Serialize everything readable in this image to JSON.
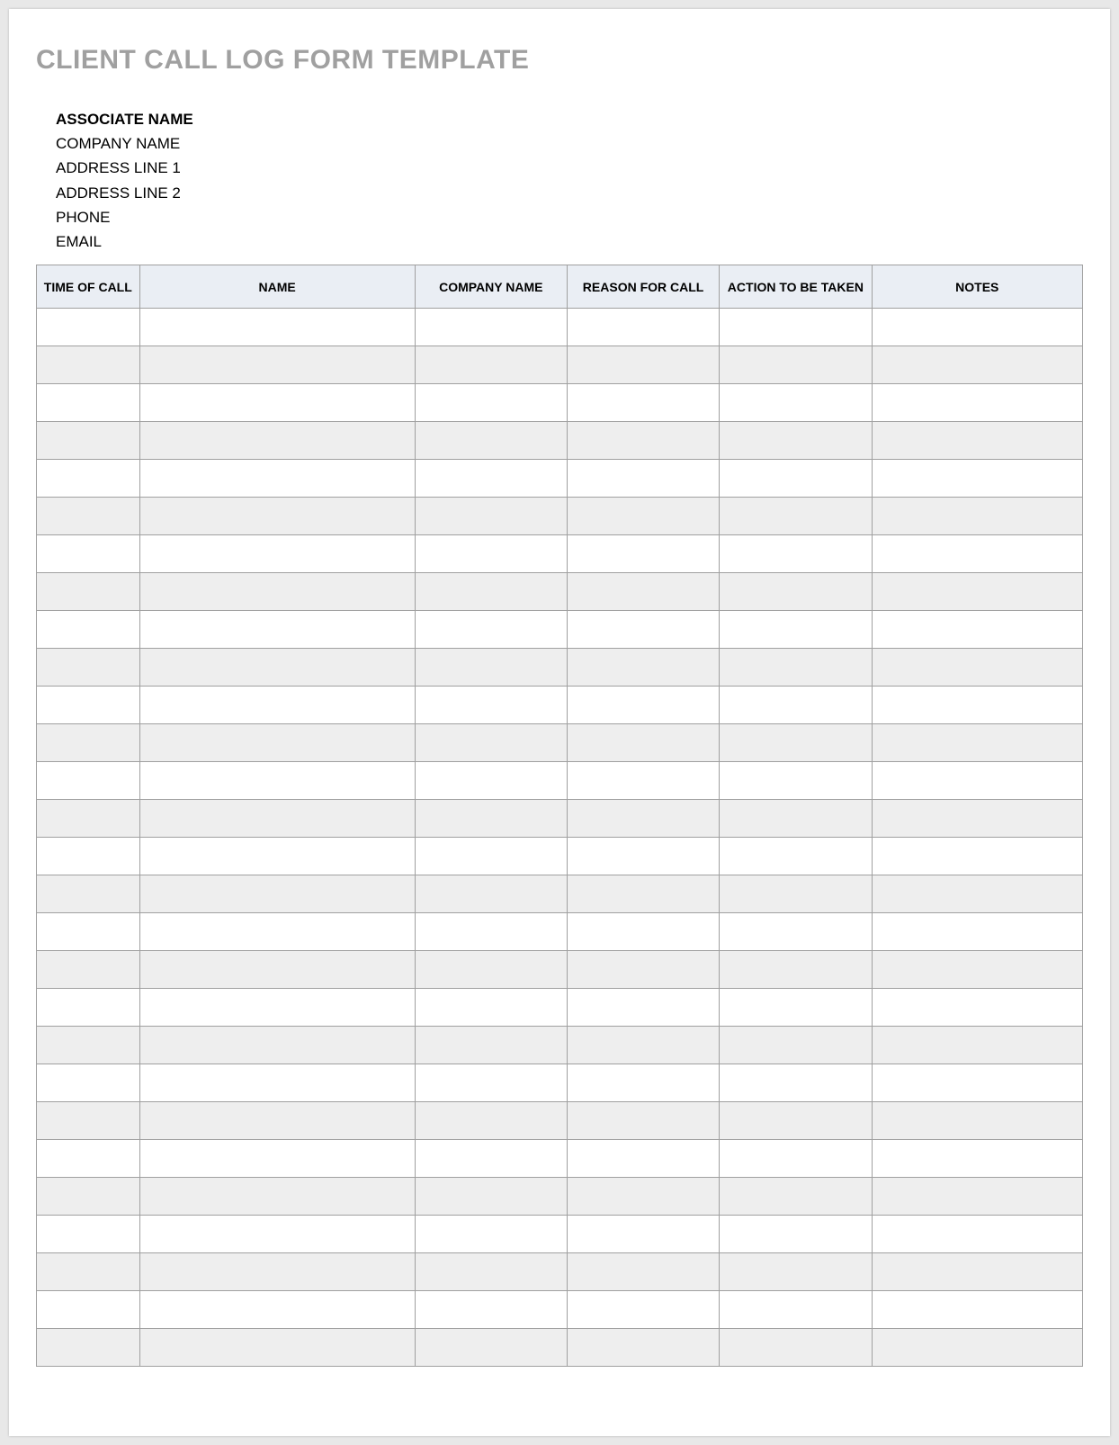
{
  "title": "CLIENT CALL LOG FORM TEMPLATE",
  "info": {
    "associate_name": "ASSOCIATE NAME",
    "company_name": "COMPANY NAME",
    "address_line_1": "ADDRESS LINE 1",
    "address_line_2": "ADDRESS LINE 2",
    "phone": "PHONE",
    "email": "EMAIL"
  },
  "table": {
    "headers": {
      "time_of_call": "TIME OF CALL",
      "name": "NAME",
      "company_name": "COMPANY NAME",
      "reason_for_call": "REASON FOR CALL",
      "action_to_be_taken": "ACTION TO BE TAKEN",
      "notes": "NOTES"
    },
    "row_count": 28
  }
}
